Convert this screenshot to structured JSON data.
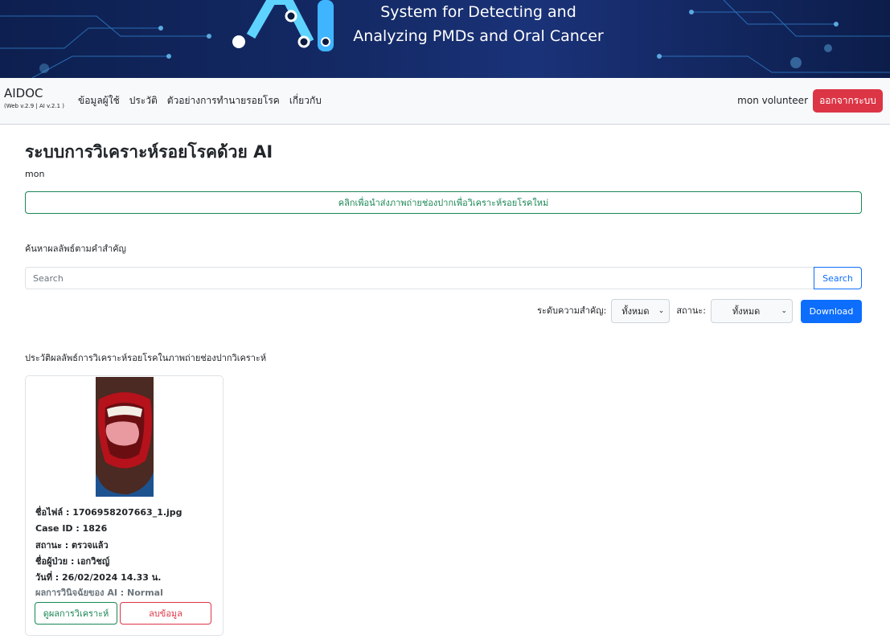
{
  "banner": {
    "title_line1": "System for Detecting and",
    "title_line2": "Analyzing PMDs and Oral Cancer"
  },
  "navbar": {
    "brand": "AIDOC",
    "version": "(Web v.2.9 | AI v.2.1 )",
    "links": [
      "ข้อมูลผู้ใช้",
      "ประวัติ",
      "ตัวอย่างการทำนายรอยโรค",
      "เกี่ยวกับ"
    ],
    "user": "mon volunteer",
    "logout_label": "ออกจากระบบ"
  },
  "main": {
    "title": "ระบบการวิเคราะห์รอยโรคด้วย AI",
    "username": "mon",
    "upload_label": "คลิกเพื่อนำส่งภาพถ่ายช่องปากเพื่อวิเคราะห์รอยโรคใหม่",
    "search_label": "ค้นหาผลลัพธ์ตามคำสำคัญ",
    "search_placeholder": "Search",
    "search_button": "Search",
    "priority_label": "ระดับความสำคัญ:",
    "priority_value": "ทั้งหมด",
    "status_label": "สถานะ:",
    "status_value": "ทั้งหมด",
    "download_button": "Download",
    "history_label": "ประวัติผลลัพธ์การวิเคราะห์รอยโรคในภาพถ่ายช่องปากวิเคราะห์"
  },
  "card": {
    "filename": "ชื่อไฟล์ : 1706958207663_1.jpg",
    "case_id": "Case ID : 1826",
    "status": "สถานะ : ตรวจแล้ว",
    "patient": "ชื่อผู้ป่วย : เอกวิชญ์",
    "date": "วันที่ : 26/02/2024 14.33 น.",
    "ai_result": "ผลการวินิจฉัยของ AI : Normal",
    "view_button": "ดูผลการวิเคราะห์",
    "delete_button": "ลบข้อมูล"
  },
  "colors": {
    "danger": "#dc3545",
    "success": "#198754",
    "primary": "#0d6efd",
    "banner": "#142a66"
  }
}
